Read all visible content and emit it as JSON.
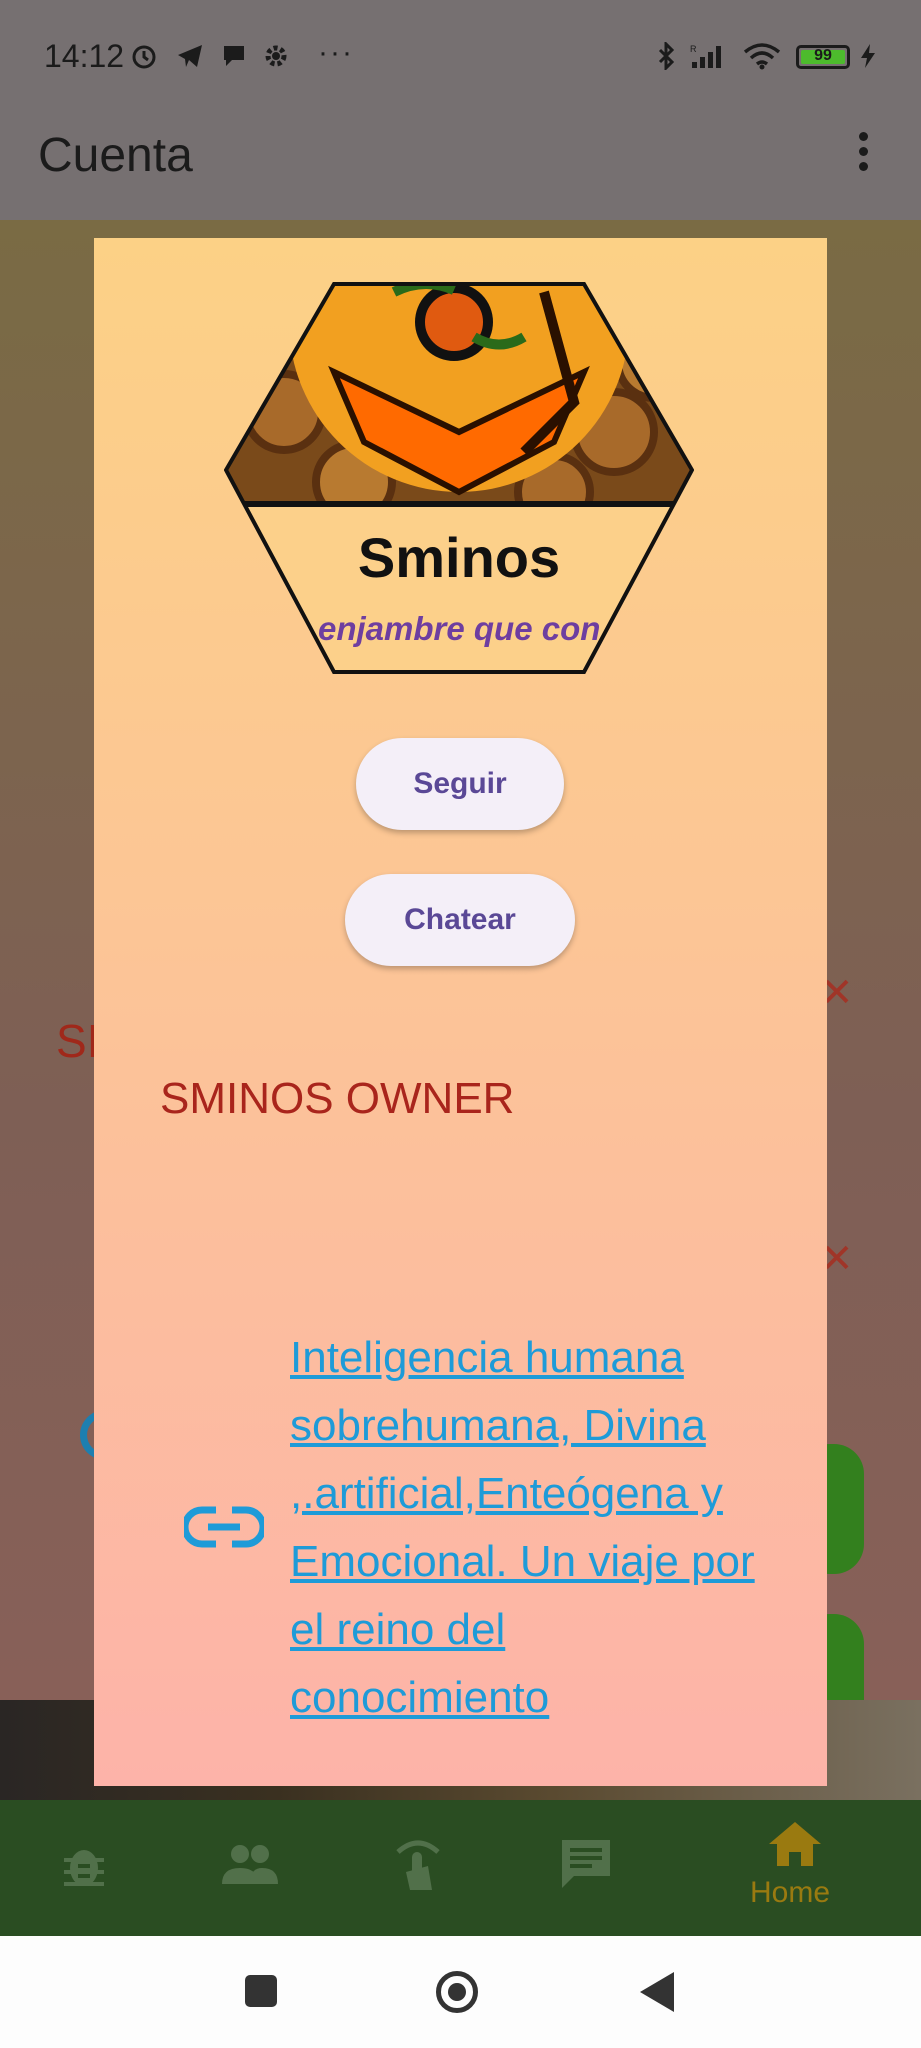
{
  "status_bar": {
    "time": "14:12",
    "battery": "99",
    "overflow_dots": "···"
  },
  "app_bar": {
    "title": "Cuenta"
  },
  "background_page": {
    "partial_text": "SI"
  },
  "dialog": {
    "brand_name": "Sminos",
    "tagline": "enjambre que conecta",
    "follow_label": "Seguir",
    "chat_label": "Chatear",
    "role": "SMINOS OWNER",
    "link_text": "Inteligencia humana sobrehumana, Divina ,.artificial,Enteógena y Emocional. Un viaje por el reino del conocimiento"
  },
  "bottom_nav": {
    "items": [
      {
        "icon": "bug-icon"
      },
      {
        "icon": "people-icon"
      },
      {
        "icon": "touch-icon"
      },
      {
        "icon": "chat-icon"
      },
      {
        "icon": "home-icon",
        "label": "Home",
        "selected": true
      }
    ]
  },
  "colors": {
    "accent_green": "#2a4d22",
    "selected_gold": "#9a7a10",
    "link_blue": "#1e9bd8",
    "role_red": "#a9251c",
    "button_text": "#5a4896"
  }
}
